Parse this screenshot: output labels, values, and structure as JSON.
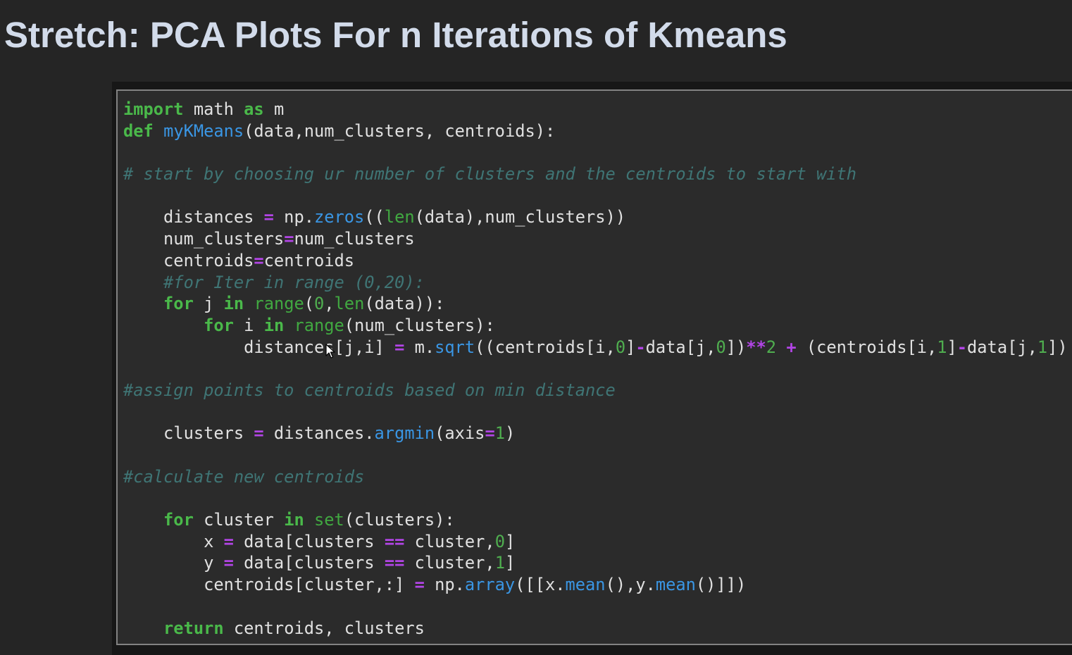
{
  "heading": "Stretch: PCA Plots For n Iterations of Kmeans",
  "colors": {
    "background": "#252525",
    "heading": "#d2dbea",
    "code_background": "#2b2b2b",
    "keyword": "#4ab94a",
    "function": "#3a96e4",
    "builtin": "#41a941",
    "operator": "#b245e6",
    "number": "#4fae4f",
    "comment": "#3f7575",
    "text": "#e1e1e1"
  },
  "code_lines": [
    [
      [
        "kw",
        "import"
      ],
      [
        "pl",
        " math "
      ],
      [
        "kw",
        "as"
      ],
      [
        "pl",
        " m"
      ]
    ],
    [
      [
        "kw",
        "def"
      ],
      [
        "pl",
        " "
      ],
      [
        "fn",
        "myKMeans"
      ],
      [
        "pl",
        "(data,num_clusters, centroids):"
      ]
    ],
    [],
    [
      [
        "cm",
        "# start by choosing ur number of clusters and the centroids to start with"
      ]
    ],
    [],
    [
      [
        "pl",
        "    distances "
      ],
      [
        "op",
        "="
      ],
      [
        "pl",
        " np."
      ],
      [
        "fn",
        "zeros"
      ],
      [
        "pl",
        "(("
      ],
      [
        "bi",
        "len"
      ],
      [
        "pl",
        "(data),num_clusters))"
      ]
    ],
    [
      [
        "pl",
        "    num_clusters"
      ],
      [
        "op",
        "="
      ],
      [
        "pl",
        "num_clusters"
      ]
    ],
    [
      [
        "pl",
        "    centroids"
      ],
      [
        "op",
        "="
      ],
      [
        "pl",
        "centroids"
      ]
    ],
    [
      [
        "pl",
        "    "
      ],
      [
        "cm",
        "#for Iter in range (0,20):"
      ]
    ],
    [
      [
        "pl",
        "    "
      ],
      [
        "kw",
        "for"
      ],
      [
        "pl",
        " j "
      ],
      [
        "kw",
        "in"
      ],
      [
        "pl",
        " "
      ],
      [
        "bi",
        "range"
      ],
      [
        "pl",
        "("
      ],
      [
        "num",
        "0"
      ],
      [
        "pl",
        ","
      ],
      [
        "bi",
        "len"
      ],
      [
        "pl",
        "(data)):"
      ]
    ],
    [
      [
        "pl",
        "        "
      ],
      [
        "kw",
        "for"
      ],
      [
        "pl",
        " i "
      ],
      [
        "kw",
        "in"
      ],
      [
        "pl",
        " "
      ],
      [
        "bi",
        "range"
      ],
      [
        "pl",
        "(num_clusters):"
      ]
    ],
    [
      [
        "pl",
        "            distances[j,i] "
      ],
      [
        "op",
        "="
      ],
      [
        "pl",
        " m."
      ],
      [
        "fn",
        "sqrt"
      ],
      [
        "pl",
        "((centroids[i,"
      ],
      [
        "num",
        "0"
      ],
      [
        "pl",
        "]"
      ],
      [
        "op",
        "-"
      ],
      [
        "pl",
        "data[j,"
      ],
      [
        "num",
        "0"
      ],
      [
        "pl",
        "])"
      ],
      [
        "op",
        "**"
      ],
      [
        "num",
        "2"
      ],
      [
        "pl",
        " "
      ],
      [
        "op",
        "+"
      ],
      [
        "pl",
        " (centroids[i,"
      ],
      [
        "num",
        "1"
      ],
      [
        "pl",
        "]"
      ],
      [
        "op",
        "-"
      ],
      [
        "pl",
        "data[j,"
      ],
      [
        "num",
        "1"
      ],
      [
        "pl",
        "])"
      ]
    ],
    [],
    [
      [
        "cm",
        "#assign points to centroids based on min distance"
      ]
    ],
    [],
    [
      [
        "pl",
        "    clusters "
      ],
      [
        "op",
        "="
      ],
      [
        "pl",
        " distances."
      ],
      [
        "fn",
        "argmin"
      ],
      [
        "pl",
        "(axis"
      ],
      [
        "op",
        "="
      ],
      [
        "num",
        "1"
      ],
      [
        "pl",
        ")"
      ]
    ],
    [],
    [
      [
        "cm",
        "#calculate new centroids"
      ]
    ],
    [],
    [
      [
        "pl",
        "    "
      ],
      [
        "kw",
        "for"
      ],
      [
        "pl",
        " cluster "
      ],
      [
        "kw",
        "in"
      ],
      [
        "pl",
        " "
      ],
      [
        "bi",
        "set"
      ],
      [
        "pl",
        "(clusters):"
      ]
    ],
    [
      [
        "pl",
        "        x "
      ],
      [
        "op",
        "="
      ],
      [
        "pl",
        " data[clusters "
      ],
      [
        "op",
        "=="
      ],
      [
        "pl",
        " cluster,"
      ],
      [
        "num",
        "0"
      ],
      [
        "pl",
        "]"
      ]
    ],
    [
      [
        "pl",
        "        y "
      ],
      [
        "op",
        "="
      ],
      [
        "pl",
        " data[clusters "
      ],
      [
        "op",
        "=="
      ],
      [
        "pl",
        " cluster,"
      ],
      [
        "num",
        "1"
      ],
      [
        "pl",
        "]"
      ]
    ],
    [
      [
        "pl",
        "        centroids[cluster,:] "
      ],
      [
        "op",
        "="
      ],
      [
        "pl",
        " np."
      ],
      [
        "fn",
        "array"
      ],
      [
        "pl",
        "([[x."
      ],
      [
        "fn",
        "mean"
      ],
      [
        "pl",
        "(),y."
      ],
      [
        "fn",
        "mean"
      ],
      [
        "pl",
        "()]])"
      ]
    ],
    [],
    [
      [
        "pl",
        "    "
      ],
      [
        "kw",
        "return"
      ],
      [
        "pl",
        " centroids, clusters"
      ]
    ]
  ]
}
